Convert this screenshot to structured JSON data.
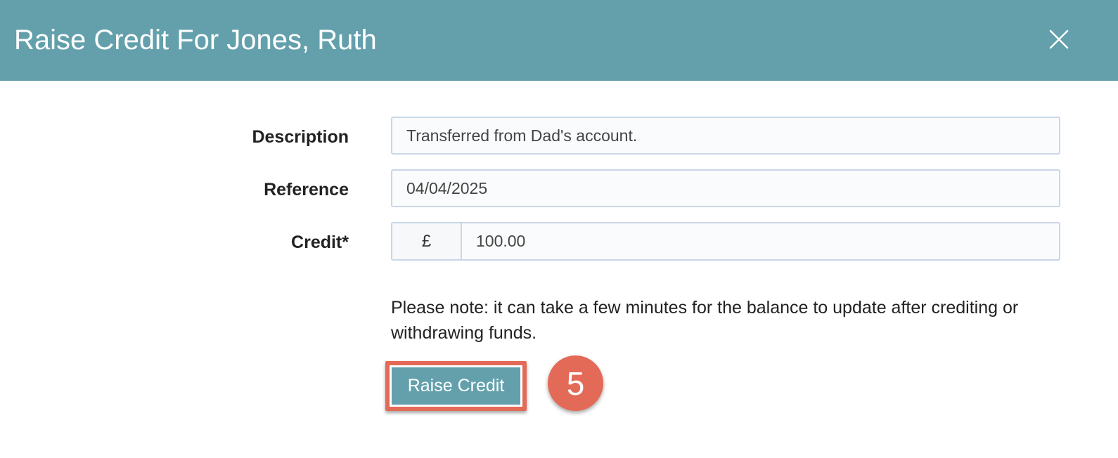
{
  "modal": {
    "title": "Raise Credit For Jones, Ruth",
    "close_icon": "close-icon"
  },
  "form": {
    "description": {
      "label": "Description",
      "value": "Transferred from Dad's account."
    },
    "reference": {
      "label": "Reference",
      "value": "04/04/2025"
    },
    "credit": {
      "label": "Credit*",
      "currency_symbol": "£",
      "value": "100.00"
    },
    "note": "Please note: it can take a few minutes for the balance to update after crediting or withdrawing funds.",
    "submit_label": "Raise Credit"
  },
  "annotation": {
    "step_number": "5"
  },
  "colors": {
    "header_bg": "#63a0ac",
    "button_bg": "#63a0ac",
    "highlight": "#e46a58",
    "input_border": "#c9d6e8"
  }
}
